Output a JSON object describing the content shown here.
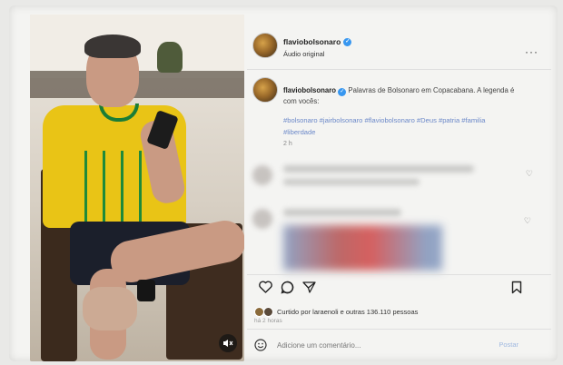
{
  "post": {
    "username": "flaviobolsonaro",
    "audio_label": "Áudio original",
    "more_label": "···"
  },
  "caption": {
    "username": "flaviobolsonaro",
    "text": "Palavras de Bolsonaro em Copacabana. A legenda é com vocês:",
    "hashtags": "#bolsonaro #jairbolsonaro #flaviobolsonaro #Deus #patria #familia #liberdade",
    "time": "2 h"
  },
  "engagement": {
    "liked_by": "Curtido por laraenoli e outras 136.110 pessoas",
    "posted_ago": "há 2 horas"
  },
  "comment_box": {
    "placeholder": "Adicione um comentário...",
    "post_label": "Postar"
  },
  "icons": {
    "audio": "audio-muted-icon",
    "like": "heart-icon",
    "comment": "comment-icon",
    "share": "send-icon",
    "save": "bookmark-icon",
    "emoji": "emoji-icon",
    "verified": "verified-badge-icon"
  },
  "colors": {
    "verified": "#3897f0",
    "hashtag": "#6c89c9",
    "post_button": "#9fb8e0"
  }
}
